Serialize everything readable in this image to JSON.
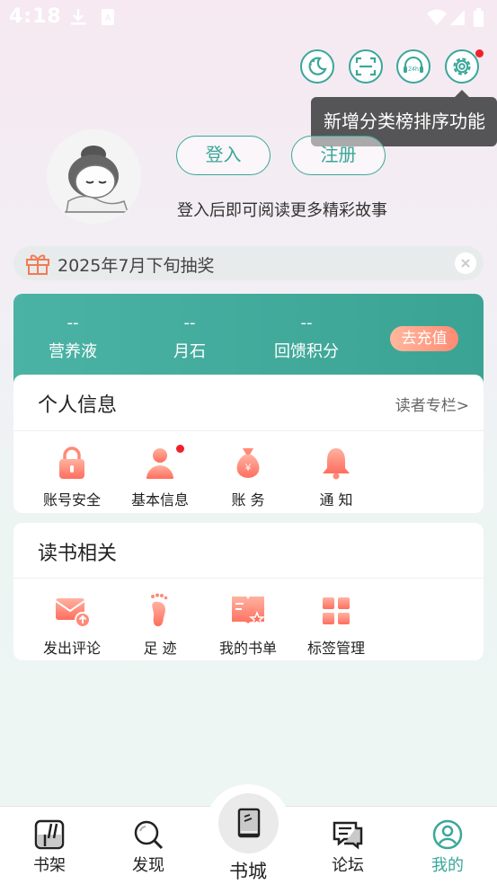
{
  "status_bar": {
    "time": "4:18"
  },
  "tooltip": {
    "text": "新增分类榜排序功能"
  },
  "auth": {
    "login_label": "登入",
    "register_label": "注册",
    "hint": "登入后即可阅读更多精彩故事"
  },
  "lottery": {
    "text": "2025年7月下旬抽奖"
  },
  "wallet": {
    "stats": [
      {
        "value": "--",
        "label": "营养液"
      },
      {
        "value": "--",
        "label": "月石"
      },
      {
        "value": "--",
        "label": "回馈积分"
      }
    ],
    "recharge_label": "去充值"
  },
  "personal": {
    "title": "个人信息",
    "link": "读者专栏>",
    "items": [
      {
        "label": "账号安全",
        "icon": "lock-icon"
      },
      {
        "label": "基本信息",
        "icon": "user-icon"
      },
      {
        "label": "账  务",
        "icon": "money-bag-icon"
      },
      {
        "label": "通  知",
        "icon": "bell-icon"
      }
    ]
  },
  "reading": {
    "title": "读书相关",
    "items": [
      {
        "label": "发出评论",
        "icon": "comment-send-icon"
      },
      {
        "label": "足 迹",
        "icon": "footprint-icon"
      },
      {
        "label": "我的书单",
        "icon": "booklist-icon"
      },
      {
        "label": "标签管理",
        "icon": "tags-icon"
      }
    ]
  },
  "bottom_nav": {
    "items": [
      {
        "label": "书架",
        "icon": "bookshelf-icon"
      },
      {
        "label": "发现",
        "icon": "discover-icon"
      },
      {
        "label": "书城",
        "icon": "bookstore-icon"
      },
      {
        "label": "论坛",
        "icon": "forum-icon"
      },
      {
        "label": "我的",
        "icon": "profile-icon"
      }
    ],
    "active_color": "#3aa79a"
  },
  "colors": {
    "accent": "#3aa79a",
    "badge": "#f0202a",
    "icon_gradient": [
      "#ffb2a1",
      "#ff6e5e"
    ]
  }
}
